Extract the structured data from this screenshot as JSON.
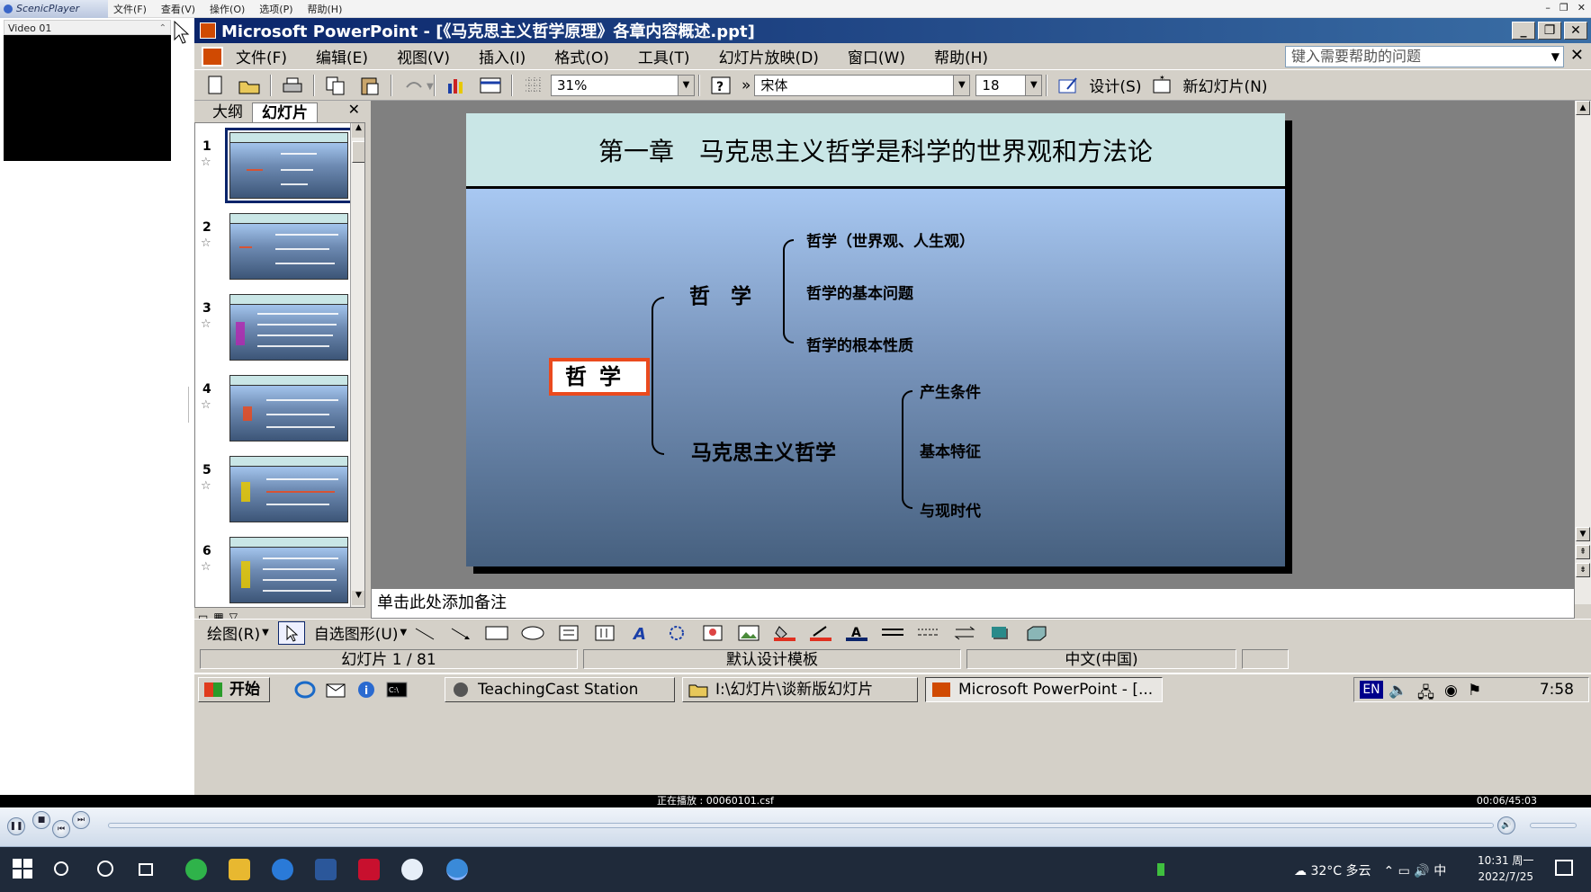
{
  "player": {
    "title": "ScenicPlayer",
    "menu": [
      "文件(F)",
      "查看(V)",
      "操作(O)",
      "选项(P)",
      "帮助(H)"
    ],
    "video_label": "Video 01",
    "now_playing": "正在播放 : 00060101.csf",
    "time": "00:06/45:03"
  },
  "ppt": {
    "window_title": "Microsoft PowerPoint - [《马克思主义哲学原理》各章内容概述.ppt]",
    "menu": [
      "文件(F)",
      "编辑(E)",
      "视图(V)",
      "插入(I)",
      "格式(O)",
      "工具(T)",
      "幻灯片放映(D)",
      "窗口(W)",
      "帮助(H)"
    ],
    "help_placeholder": "键入需要帮助的问题",
    "zoom": "31%",
    "font": "宋体",
    "font_size": "18",
    "design_label": "设计(S)",
    "new_slide_label": "新幻灯片(N)",
    "pane_tabs": [
      "大纲",
      "幻灯片"
    ],
    "thumbs": [
      "1",
      "2",
      "3",
      "4",
      "5",
      "6"
    ],
    "notes_placeholder": "单击此处添加备注",
    "draw_label": "绘图(R)",
    "autoshape_label": "自选图形(U)",
    "status": {
      "slide": "幻灯片 1 / 81",
      "template": "默认设计模板",
      "language": "中文(中国)"
    }
  },
  "slide": {
    "title": "第一章　马克思主义哲学是科学的世界观和方法论",
    "root": "哲学",
    "branch1": "哲　学",
    "branch1_items": [
      "哲学（世界观、人生观）",
      "哲学的基本问题",
      "哲学的根本性质"
    ],
    "branch2": "马克思主义哲学",
    "branch2_items": [
      "产生条件",
      "基本特征",
      "与现时代"
    ]
  },
  "taskbar98": {
    "start": "开始",
    "tasks": [
      "TeachingCast Station",
      "I:\\幻灯片\\谈新版幻灯片",
      "Microsoft PowerPoint - [..."
    ],
    "ime": "EN",
    "clock": "7:58"
  },
  "win10": {
    "weather": "32°C 多云",
    "ime": "中",
    "time": "10:31 周一",
    "date": "2022/7/25"
  },
  "colors": {
    "ppt_title_bar": "#0a246a",
    "slide_header": "#c9e6e6",
    "root_border": "#ea4a1e",
    "win10_taskbar": "#1f2a3a"
  }
}
